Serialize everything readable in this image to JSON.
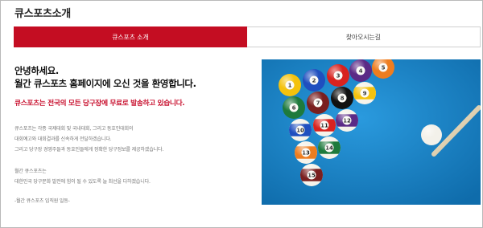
{
  "page": {
    "title": "큐스포츠소개"
  },
  "tabs": [
    {
      "label": "큐스포츠 소개",
      "active": true
    },
    {
      "label": "찾아오시는길",
      "active": false
    }
  ],
  "intro": {
    "greeting_line1": "안녕하세요.",
    "greeting_line2": "월간 큐스포츠 홈페이지에 오신 것을 환영합니다.",
    "highlight": "큐스포츠는 전국의 모든 당구장에 무료로 발송하고 있습니다.",
    "para1": [
      "큐스포츠는 각종 국제대회 및 국내대회, 그리고 동호인대회의",
      "대회예고와 대회결과를 신속하게 전달하겠습니다.",
      "그리고 당구장 경영주들과 동호인들에게 정확한 당구정보를 제공하겠습니다."
    ],
    "para2": [
      "월간 큐스포츠는",
      "대한민국 당구문화 발전에 힘이 될 수 있도록 늘 최선을 다하겠습니다."
    ],
    "signature": "-월간 큐스포츠 임직원 일동-"
  },
  "colors": {
    "accent": "#c40d22",
    "highlight": "#c8102e",
    "felt": "#1a86c8"
  },
  "photo": {
    "ball_numbers": [
      "1",
      "2",
      "3",
      "4",
      "5",
      "6",
      "7",
      "8",
      "9",
      "10",
      "11",
      "12",
      "13",
      "14",
      "15"
    ]
  }
}
